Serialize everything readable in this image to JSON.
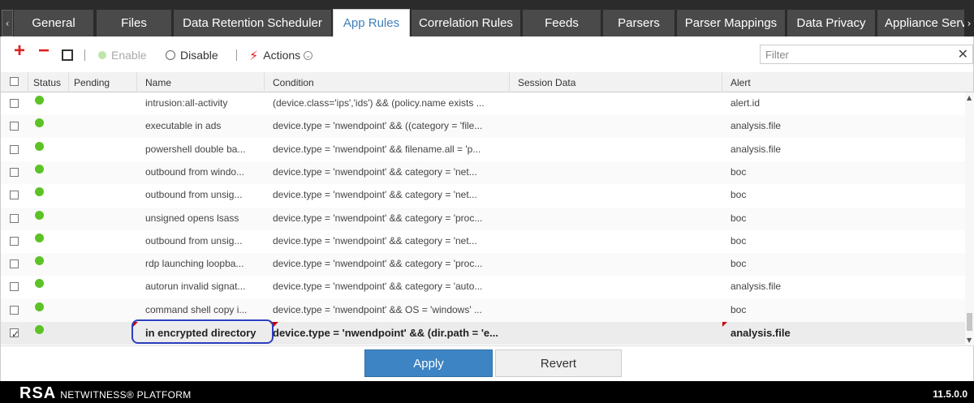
{
  "tabs": [
    {
      "label": "General",
      "active": false
    },
    {
      "label": "Files",
      "active": false
    },
    {
      "label": "Data Retention Scheduler",
      "active": false
    },
    {
      "label": "App Rules",
      "active": true
    },
    {
      "label": "Correlation Rules",
      "active": false
    },
    {
      "label": "Feeds",
      "active": false
    },
    {
      "label": "Parsers",
      "active": false
    },
    {
      "label": "Parser Mappings",
      "active": false
    },
    {
      "label": "Data Privacy",
      "active": false
    },
    {
      "label": "Appliance Serv",
      "active": false
    }
  ],
  "nav": {
    "left": "‹",
    "right": "›"
  },
  "toolbar": {
    "add": "+",
    "remove": "−",
    "enable": "Enable",
    "disable": "Disable",
    "actions": "Actions",
    "bolt": "⚡",
    "chevron": "⌄",
    "filter_placeholder": "Filter",
    "filter_clear": "✕"
  },
  "columns": [
    "Status",
    "Pending",
    "Name",
    "Condition",
    "Session Data",
    "Alert"
  ],
  "rows": [
    {
      "status": "enabled",
      "name": "intrusion:all-activity",
      "condition": "(device.class='ips','ids') && (policy.name exists ...",
      "session_data": "",
      "alert": "alert.id",
      "checked": false
    },
    {
      "status": "enabled",
      "name": "executable in ads",
      "condition": "device.type = 'nwendpoint' && ((category = 'file...",
      "session_data": "",
      "alert": "analysis.file",
      "checked": false
    },
    {
      "status": "enabled",
      "name": "powershell double ba...",
      "condition": "device.type = 'nwendpoint' && filename.all = 'p...",
      "session_data": "",
      "alert": "analysis.file",
      "checked": false
    },
    {
      "status": "enabled",
      "name": "outbound from windo...",
      "condition": "device.type = 'nwendpoint' && category = 'net...",
      "session_data": "",
      "alert": "boc",
      "checked": false
    },
    {
      "status": "enabled",
      "name": "outbound from unsig...",
      "condition": "device.type = 'nwendpoint' && category = 'net...",
      "session_data": "",
      "alert": "boc",
      "checked": false
    },
    {
      "status": "enabled",
      "name": "unsigned opens lsass",
      "condition": "device.type = 'nwendpoint' && category = 'proc...",
      "session_data": "",
      "alert": "boc",
      "checked": false
    },
    {
      "status": "enabled",
      "name": "outbound from unsig...",
      "condition": "device.type = 'nwendpoint' && category = 'net...",
      "session_data": "",
      "alert": "boc",
      "checked": false
    },
    {
      "status": "enabled",
      "name": "rdp launching loopba...",
      "condition": "device.type = 'nwendpoint' && category = 'proc...",
      "session_data": "",
      "alert": "boc",
      "checked": false
    },
    {
      "status": "enabled",
      "name": "autorun invalid signat...",
      "condition": "device.type = 'nwendpoint' && category = 'auto...",
      "session_data": "",
      "alert": "analysis.file",
      "checked": false
    },
    {
      "status": "enabled",
      "name": "command shell copy i...",
      "condition": "device.type = 'nwendpoint' && OS = 'windows' ...",
      "session_data": "",
      "alert": "boc",
      "checked": false
    },
    {
      "status": "enabled",
      "name": "in encrypted directory",
      "condition": "device.type = 'nwendpoint' && (dir.path = 'e...",
      "session_data": "",
      "alert": "analysis.file",
      "checked": true
    }
  ],
  "check_glyph": "✓",
  "scroll": {
    "up": "▲",
    "down": "▼"
  },
  "buttons": {
    "apply": "Apply",
    "revert": "Revert"
  },
  "footer": {
    "brand": "RSA",
    "product": "NETWITNESS® PLATFORM",
    "version": "11.5.0.0"
  },
  "colors": {
    "accent": "#3d84c4",
    "status_on": "#5cc225",
    "tab_bg": "#4a4a4a",
    "highlight": "#2b3fbf",
    "add_remove": "#e02020"
  }
}
